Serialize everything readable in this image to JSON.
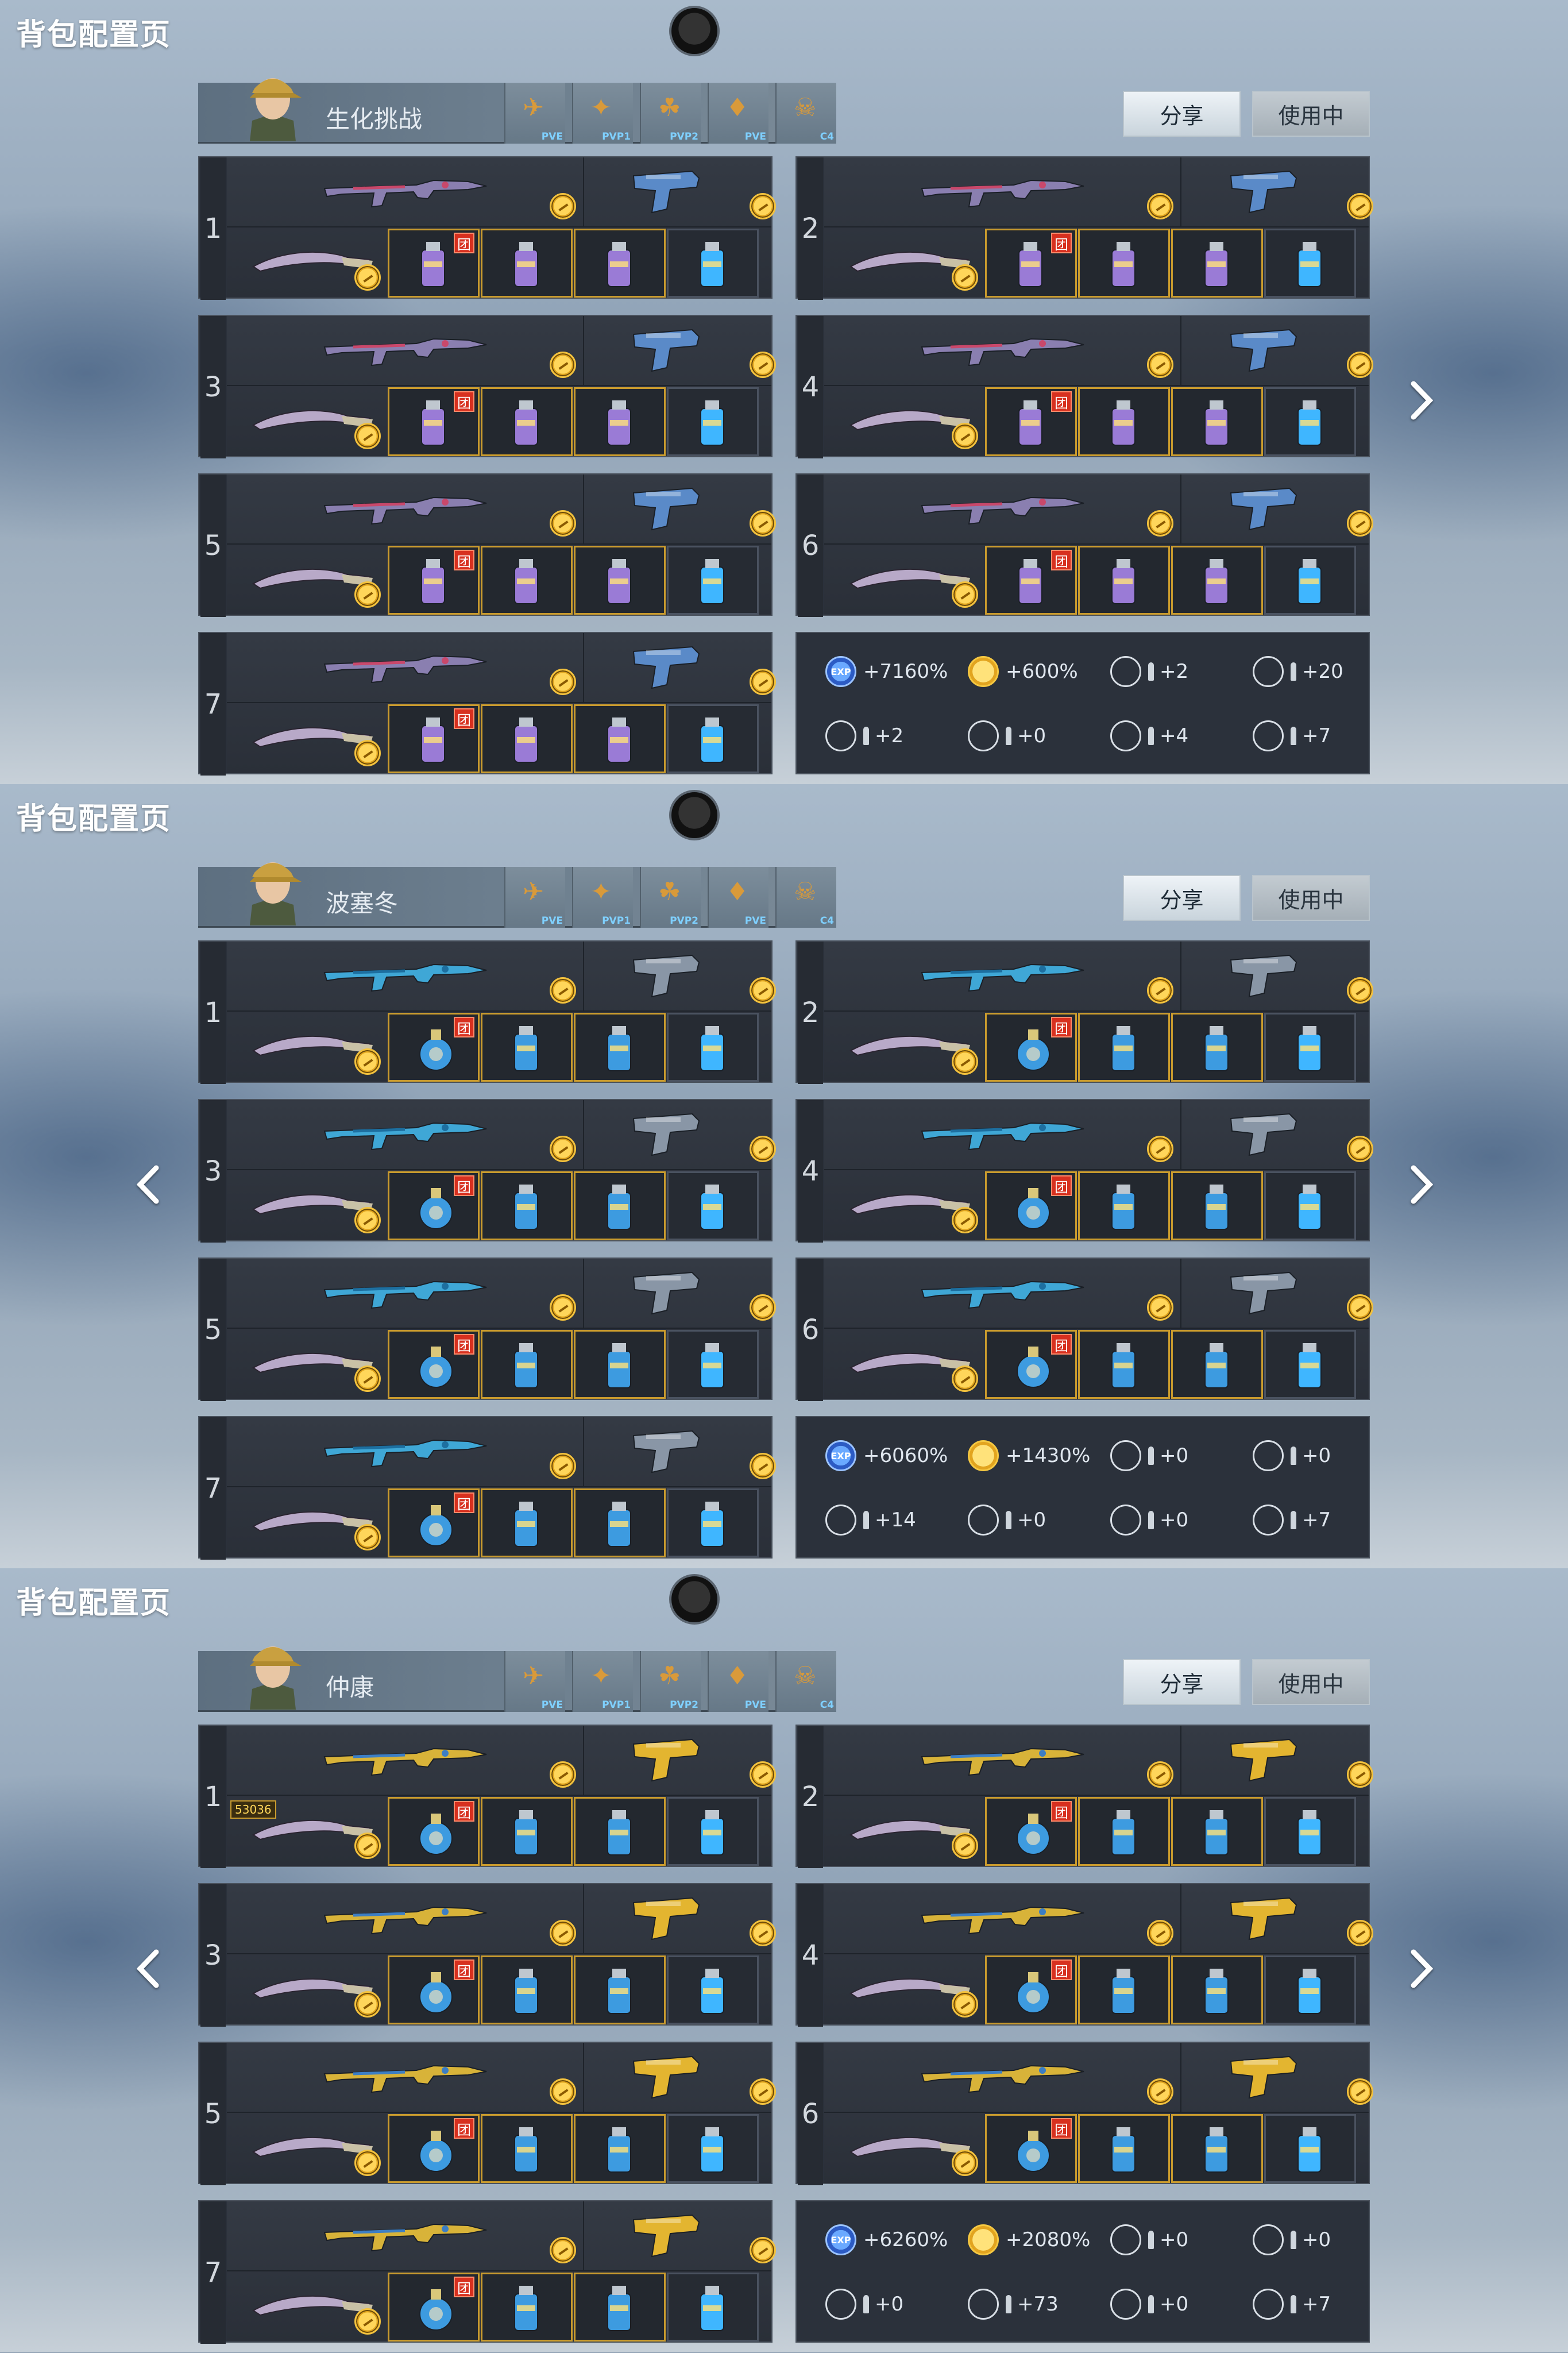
{
  "pages": [
    {
      "title": "背包配置页",
      "mode_name": "生化挑战",
      "mode_tags": [
        "PVE",
        "PVP1",
        "PVP2",
        "PVE",
        "C4"
      ],
      "share_label": "分享",
      "inuse_label": "使用中",
      "theme": {
        "gun": "#8a7fb0",
        "gun_accent": "#c9486b",
        "pistol": "#5a8ac8",
        "grenade": "#9a7bd6"
      },
      "slots": [
        "1",
        "2",
        "3",
        "4",
        "5",
        "6",
        "7"
      ],
      "team_badge": "团",
      "stats": [
        "+7160%",
        "+600%",
        "+2",
        "+20",
        "+2",
        "+0",
        "+4",
        "+7"
      ],
      "show_prev": false,
      "show_next": true
    },
    {
      "title": "背包配置页",
      "mode_name": "波塞冬",
      "mode_tags": [
        "PVE",
        "PVP1",
        "PVP2",
        "PVE",
        "C4"
      ],
      "share_label": "分享",
      "inuse_label": "使用中",
      "theme": {
        "gun": "#3fa7d6",
        "gun_accent": "#1d6fa0",
        "pistol": "#8996a6",
        "grenade": "#3d9be0"
      },
      "slots": [
        "1",
        "2",
        "3",
        "4",
        "5",
        "6",
        "7"
      ],
      "team_badge": "团",
      "stats": [
        "+6060%",
        "+1430%",
        "+0",
        "+0",
        "+14",
        "+0",
        "+0",
        "+7"
      ],
      "show_prev": true,
      "show_next": true
    },
    {
      "title": "背包配置页",
      "mode_name": "仲康",
      "mode_tags": [
        "PVE",
        "PVP1",
        "PVP2",
        "PVE",
        "C4"
      ],
      "share_label": "分享",
      "inuse_label": "使用中",
      "theme": {
        "gun": "#d8b339",
        "gun_accent": "#3c7ec4",
        "pistol": "#e3b530",
        "grenade": "#3d9be0"
      },
      "slots": [
        "1",
        "2",
        "3",
        "4",
        "5",
        "6",
        "7"
      ],
      "team_badge": "团",
      "stats": [
        "+6260%",
        "+2080%",
        "+0",
        "+0",
        "+0",
        "+73",
        "+0",
        "+7"
      ],
      "show_prev": true,
      "show_next": true,
      "extra_badge": "53036"
    }
  ]
}
